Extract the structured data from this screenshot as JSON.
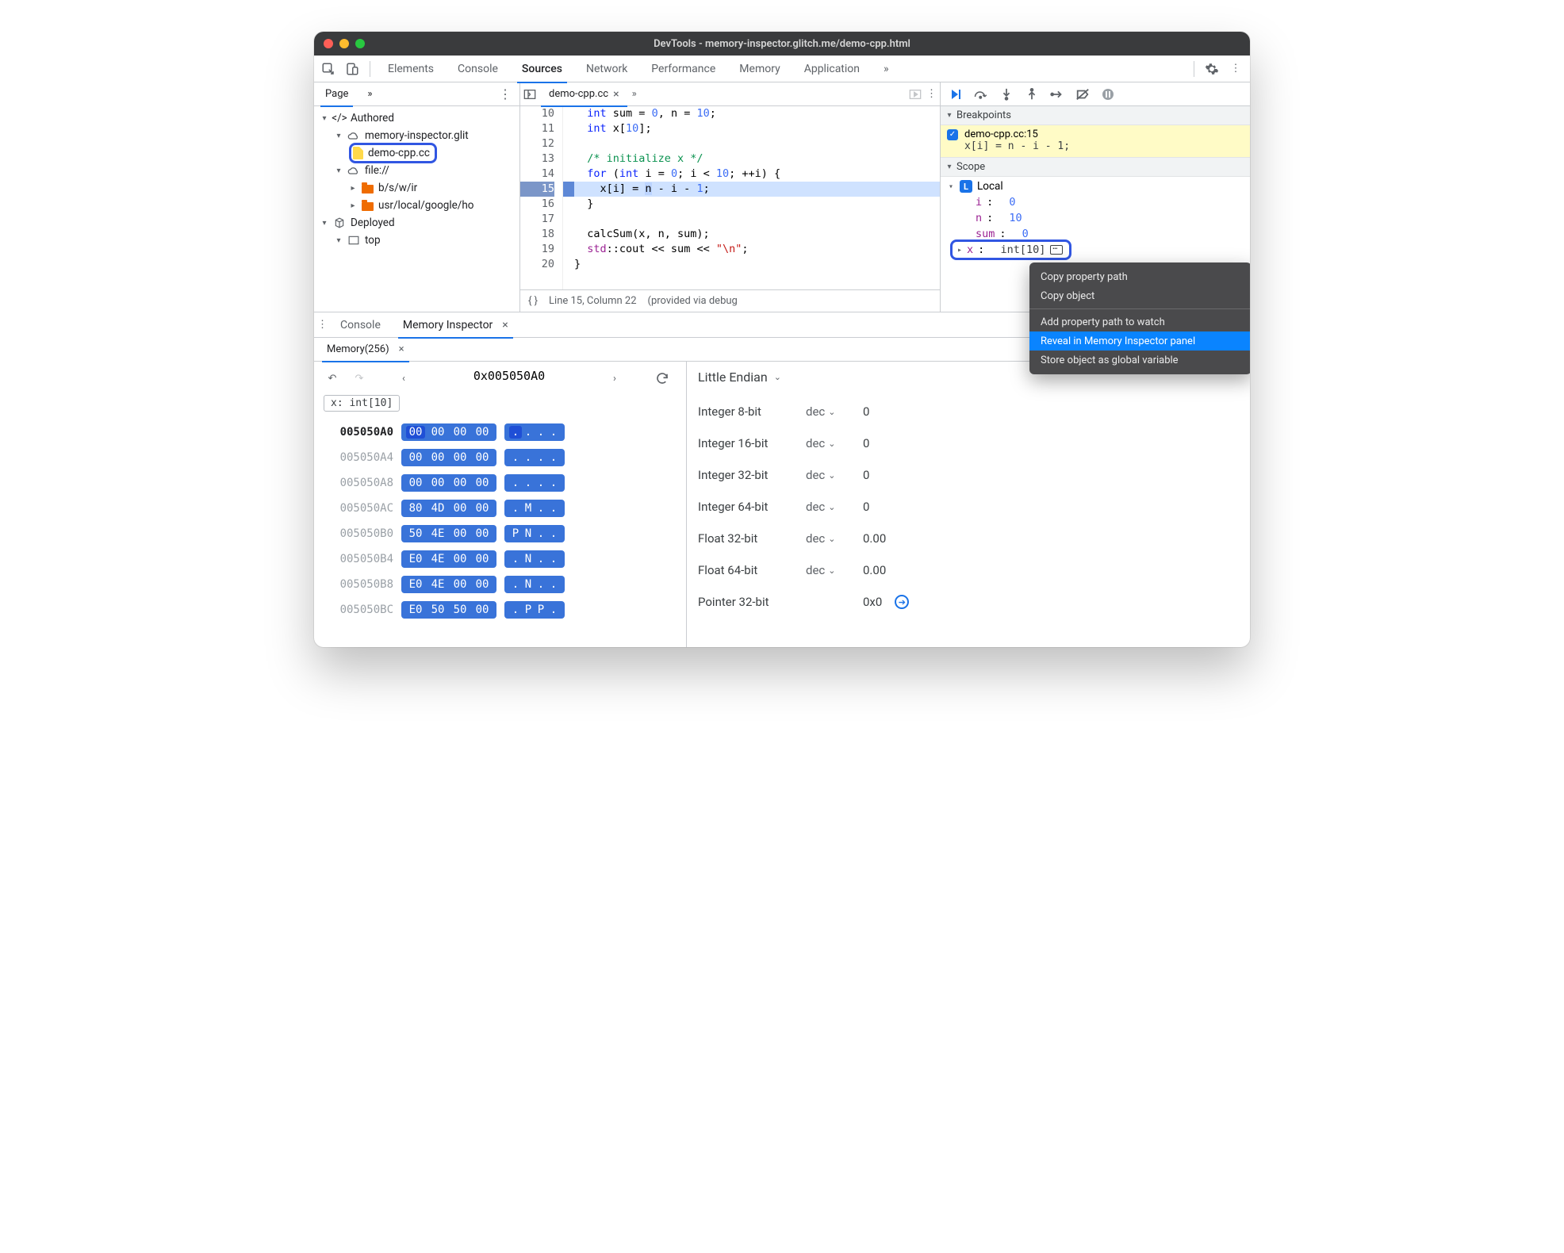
{
  "window": {
    "title": "DevTools - memory-inspector.glitch.me/demo-cpp.html"
  },
  "maintabs": {
    "items": [
      "Elements",
      "Console",
      "Sources",
      "Network",
      "Performance",
      "Memory",
      "Application"
    ],
    "active": "Sources",
    "more": "»"
  },
  "navigator": {
    "tab": "Page",
    "more": "»",
    "tree": {
      "authored": "Authored",
      "domain": "memory-inspector.glit",
      "file": "demo-cpp.cc",
      "file_scheme": "file://",
      "folder_a": "b/s/w/ir",
      "folder_b": "usr/local/google/ho",
      "deployed": "Deployed",
      "top": "top"
    }
  },
  "editor": {
    "tab": "demo-cpp.cc",
    "more": "»",
    "lines": {
      "10": {
        "n": "10",
        "html": "  <span class='ty'>int</span> sum = <span class='num'>0</span>, n = <span class='num'>10</span>;"
      },
      "11": {
        "n": "11",
        "html": "  <span class='ty'>int</span> x[<span class='num'>10</span>];"
      },
      "12": {
        "n": "12",
        "html": ""
      },
      "13": {
        "n": "13",
        "html": "  <span class='cm'>/* initialize x */</span>"
      },
      "14": {
        "n": "14",
        "html": "  <span class='kw'>for</span> (<span class='ty'>int</span> i = <span class='num'>0</span>; i &lt; <span class='num'>10</span>; ++i) {"
      },
      "15": {
        "n": "15",
        "html": "    x[i] = <span class='sel'>n</span> - i - <span class='num'>1</span>;"
      },
      "16": {
        "n": "16",
        "html": "  }"
      },
      "17": {
        "n": "17",
        "html": ""
      },
      "18": {
        "n": "18",
        "html": "  calcSum(x, n, sum);"
      },
      "19": {
        "n": "19",
        "html": "  <span class='pp'>std</span>::cout &lt;&lt; sum &lt;&lt; <span class='str'>\"\\n\"</span>;"
      },
      "20": {
        "n": "20",
        "html": "}"
      }
    },
    "status": {
      "braces": "{ }",
      "pos": "Line 15, Column 22",
      "note": "(provided via debug"
    }
  },
  "debugger": {
    "breakpoints_hdr": "Breakpoints",
    "bp_label": "demo-cpp.cc:15",
    "bp_code": "x[i] = n - i - 1;",
    "scope_hdr": "Scope",
    "local_label": "Local",
    "vars": {
      "i": {
        "name": "i",
        "value": "0"
      },
      "n": {
        "name": "n",
        "value": "10"
      },
      "sum": {
        "name": "sum",
        "value": "0"
      },
      "x": {
        "name": "x",
        "type": "int[10]"
      }
    }
  },
  "context_menu": {
    "copy_path": "Copy property path",
    "copy_obj": "Copy object",
    "add_watch": "Add property path to watch",
    "reveal": "Reveal in Memory Inspector panel",
    "store": "Store object as global variable"
  },
  "drawer": {
    "console_tab": "Console",
    "mi_tab": "Memory Inspector",
    "mem_tab": "Memory(256)"
  },
  "memory": {
    "address": "0x005050A0",
    "tag": "x: int[10]",
    "rows": [
      {
        "addr": "005050A0",
        "bytes": [
          "00",
          "00",
          "00",
          "00"
        ],
        "ascii": [
          ".",
          ".",
          ".",
          "."
        ]
      },
      {
        "addr": "005050A4",
        "bytes": [
          "00",
          "00",
          "00",
          "00"
        ],
        "ascii": [
          ".",
          ".",
          ".",
          "."
        ]
      },
      {
        "addr": "005050A8",
        "bytes": [
          "00",
          "00",
          "00",
          "00"
        ],
        "ascii": [
          ".",
          ".",
          ".",
          "."
        ]
      },
      {
        "addr": "005050AC",
        "bytes": [
          "80",
          "4D",
          "00",
          "00"
        ],
        "ascii": [
          ".",
          "M",
          ".",
          "."
        ]
      },
      {
        "addr": "005050B0",
        "bytes": [
          "50",
          "4E",
          "00",
          "00"
        ],
        "ascii": [
          "P",
          "N",
          ".",
          "."
        ]
      },
      {
        "addr": "005050B4",
        "bytes": [
          "E0",
          "4E",
          "00",
          "00"
        ],
        "ascii": [
          ".",
          "N",
          ".",
          "."
        ]
      },
      {
        "addr": "005050B8",
        "bytes": [
          "E0",
          "4E",
          "00",
          "00"
        ],
        "ascii": [
          ".",
          "N",
          ".",
          "."
        ]
      },
      {
        "addr": "005050BC",
        "bytes": [
          "E0",
          "50",
          "50",
          "00"
        ],
        "ascii": [
          ".",
          "P",
          "P",
          "."
        ]
      }
    ],
    "endian_label": "Little Endian",
    "fmt": "dec",
    "values": [
      {
        "label": "Integer 8-bit",
        "fmt": "dec",
        "val": "0"
      },
      {
        "label": "Integer 16-bit",
        "fmt": "dec",
        "val": "0"
      },
      {
        "label": "Integer 32-bit",
        "fmt": "dec",
        "val": "0"
      },
      {
        "label": "Integer 64-bit",
        "fmt": "dec",
        "val": "0"
      },
      {
        "label": "Float 32-bit",
        "fmt": "dec",
        "val": "0.00"
      },
      {
        "label": "Float 64-bit",
        "fmt": "dec",
        "val": "0.00"
      },
      {
        "label": "Pointer 32-bit",
        "fmt": "",
        "val": "0x0"
      }
    ]
  }
}
